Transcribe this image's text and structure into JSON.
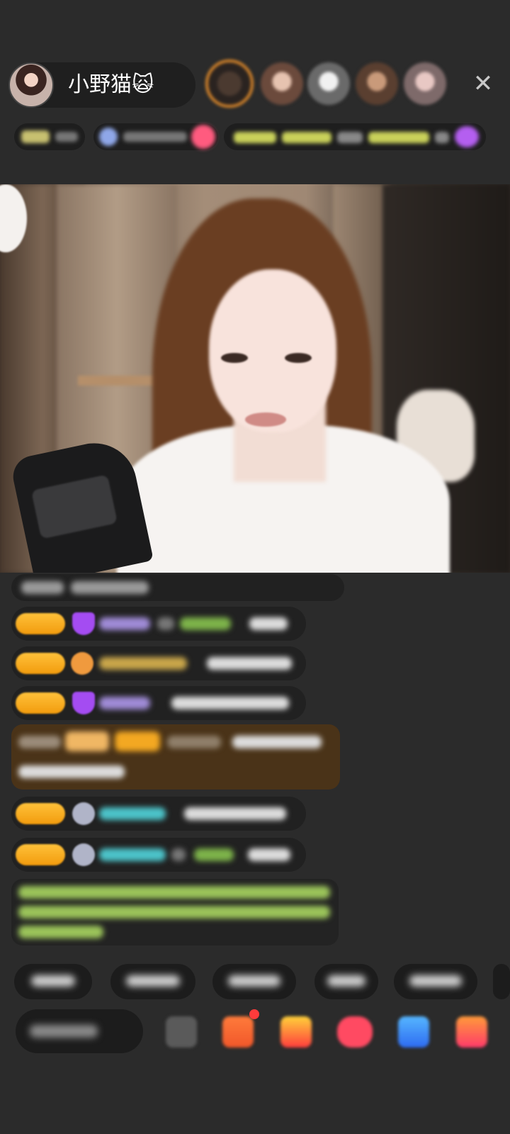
{
  "header": {
    "streamer_name": "小野猫🙀",
    "close_icon": "✕"
  },
  "colors": {
    "background": "#2b2b2b",
    "chip_background": "#1f1f1f",
    "level_badge": "#f6ad1e",
    "gift_highlight": "#4a3318",
    "notice_text": "#8bc34a"
  }
}
